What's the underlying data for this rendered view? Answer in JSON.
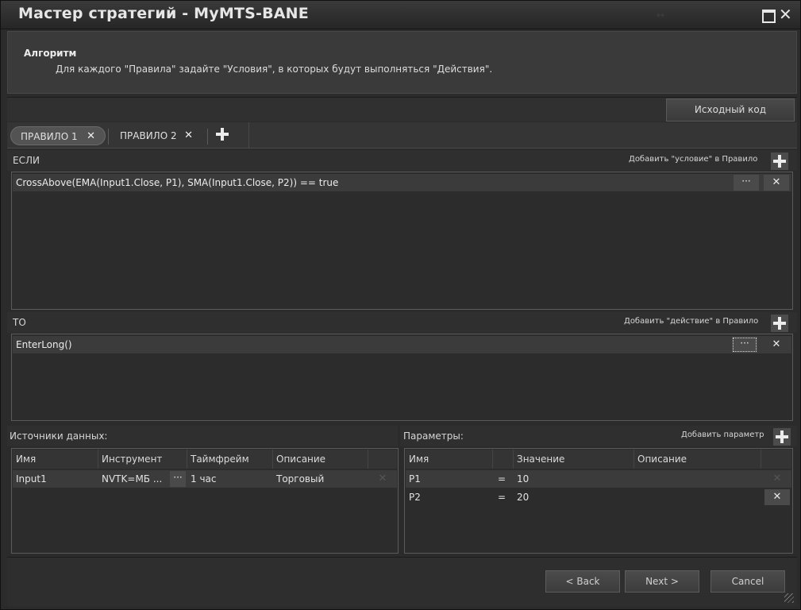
{
  "window": {
    "title": "Мастер стратегий - MyMTS-BANE",
    "drag_glyph": "↔"
  },
  "header": {
    "title": "Алгоритм",
    "description": "Для каждого \"Правила\" задайте \"Условия\", в которых будут выполняться \"Действия\"."
  },
  "toolbar": {
    "source_code_label": "Исходный код"
  },
  "tabs": [
    {
      "label": "ПРАВИЛО 1",
      "selected": true
    },
    {
      "label": "ПРАВИЛО 2",
      "selected": false
    }
  ],
  "if_section": {
    "label": "ЕСЛИ",
    "add_label": "Добавить \"условие\" в Правило",
    "conditions": [
      "CrossAbove(EMA(Input1.Close, P1), SMA(Input1.Close, P2)) == true"
    ]
  },
  "then_section": {
    "label": "ТО",
    "add_label": "Добавить \"действие\" в Правило",
    "actions": [
      "EnterLong()"
    ]
  },
  "data_sources": {
    "label": "Источники данных:",
    "columns": [
      "Имя",
      "Инструмент",
      "Таймфрейм",
      "Описание"
    ],
    "rows": [
      {
        "name": "Input1",
        "instrument": "NVTK=МБ ...",
        "timeframe": "1 час",
        "description": "Торговый"
      }
    ]
  },
  "parameters": {
    "label": "Параметры:",
    "add_label": "Добавить параметр",
    "columns": [
      "Имя",
      "Значение",
      "Описание"
    ],
    "rows": [
      {
        "name": "P1",
        "eq": "=",
        "value": "10",
        "description": ""
      },
      {
        "name": "P2",
        "eq": "=",
        "value": "20",
        "description": ""
      }
    ]
  },
  "common": {
    "ellipsis": "···",
    "close_glyph": "✕"
  },
  "footer": {
    "back_label": "< Back",
    "next_label": "Next >",
    "cancel_label": "Cancel"
  },
  "colors": {
    "background": "#2b2b2b",
    "panel": "#2c2c2c",
    "row": "#3b3b3b",
    "text": "#d8d8d8"
  }
}
